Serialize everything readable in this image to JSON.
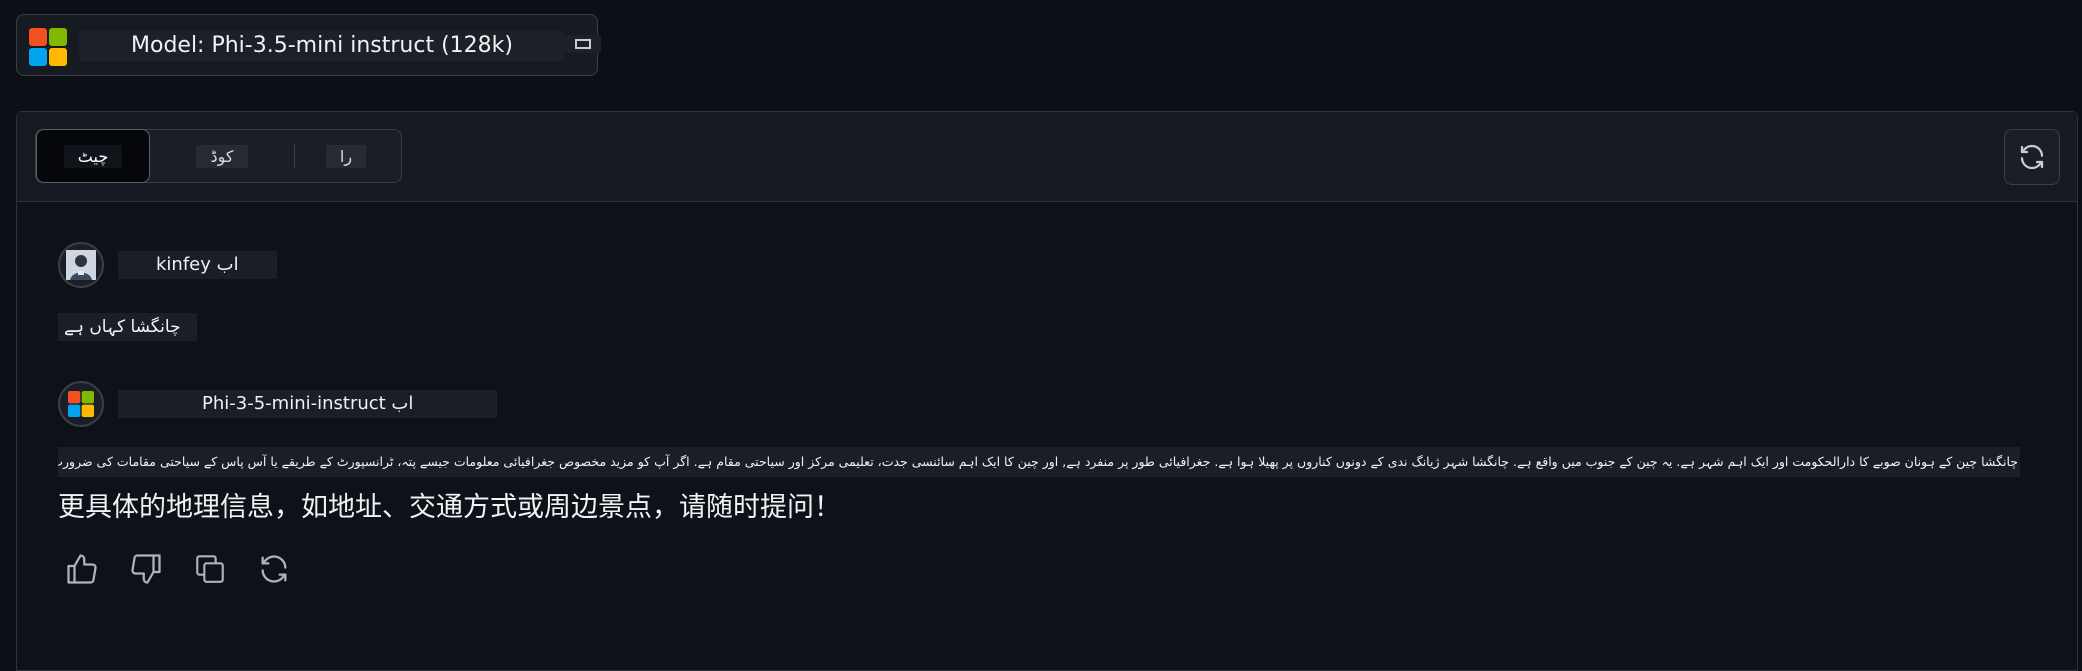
{
  "model_selector": {
    "label": "Model: Phi-3.5-mini instruct (128k)"
  },
  "tabs": [
    {
      "label": "چیٹ",
      "active": true
    },
    {
      "label": "کوڈ",
      "active": false
    },
    {
      "label": "را",
      "active": false
    }
  ],
  "messages": [
    {
      "sender": "kinfey اب",
      "text": "چانگشا کہاں ہے"
    },
    {
      "sender": "Phi-3-5-mini-instruct اب",
      "text_urdu": "چانگشا چین کے ہونان صوبے کا دارالحکومت اور ایک اہم شہر ہے. یہ چین کے جنوب میں واقع ہے. چانگشا شہر ژیانگ ندی کے دونوں کناروں پر پھیلا ہوا ہے. جغرافیائی طور پر منفرد ہے, اور چین کا ایک اہم سائنسی جدت، تعلیمی مرکز اور سیاحتی مقام ہے. اگر آپ کو مزید مخصوص جغرافیائی معلومات جیسے پتہ، ٹرانسپورٹ کے طریقے یا آس پاس کے سیاحتی مقامات کی ضرورت ہو تو بلا جھجھک پوچھیں!",
      "text_cn": "更具体的地理信息，如地址、交通方式或周边景点，请随时提问！"
    }
  ],
  "icons": {
    "logo": "microsoft-logo-icon",
    "toggle": "panel-toggle-icon",
    "refresh": "refresh-icon",
    "like": "thumbs-up-icon",
    "dislike": "thumbs-down-icon",
    "copy": "copy-icon",
    "retry": "retry-icon"
  },
  "colors": {
    "background": "#0c0f15",
    "logo_red": "#f25022",
    "logo_green": "#7fba00",
    "logo_blue": "#00a4ef",
    "logo_yellow": "#ffb900"
  }
}
